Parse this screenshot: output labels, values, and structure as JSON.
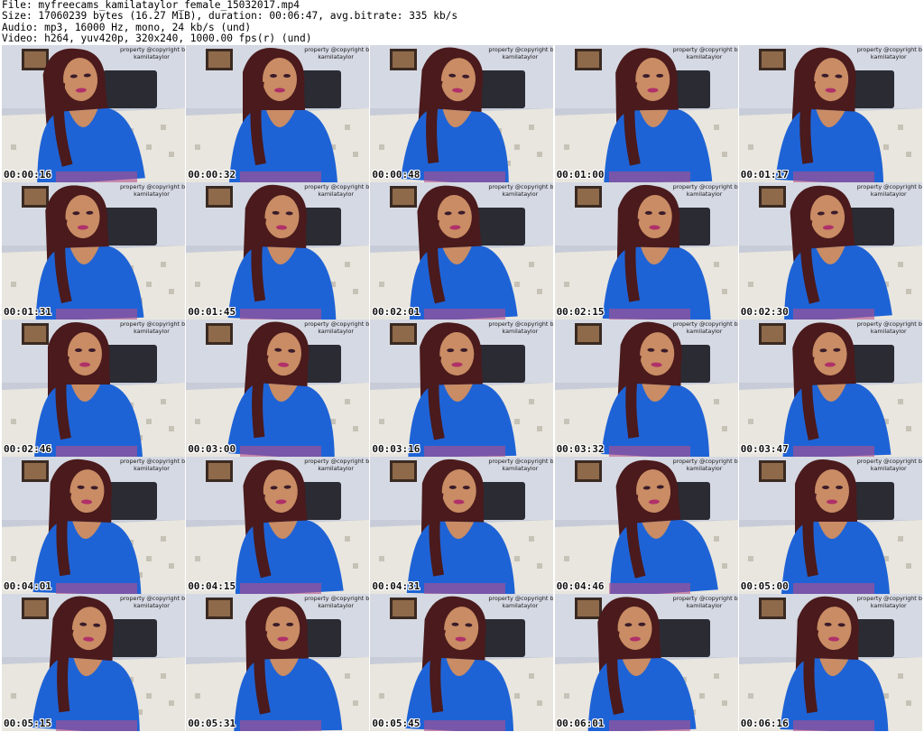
{
  "header": {
    "file": "File: myfreecams_kamilataylor_female_15032017.mp4",
    "size": "Size: 17060239 bytes (16.27 MiB), duration: 00:06:47, avg.bitrate: 335 kb/s",
    "audio": "Audio: mp3, 16000 Hz, mono, 24 kb/s (und)",
    "video": "Video: h264, yuv420p, 320x240, 1000.00 fps(r) (und)"
  },
  "watermark": {
    "line1": "property @copyright b",
    "line2": "kamilataylor"
  },
  "colors": {
    "wall": "#c7ccd8",
    "headboard": "#2b2b33",
    "shirt": "#1e63d6",
    "hair": "#4a1a1c",
    "skin": "#c98c64",
    "bedding": "#e9e6df"
  },
  "frames": [
    {
      "time": "00:00:16"
    },
    {
      "time": "00:00:32"
    },
    {
      "time": "00:00:48"
    },
    {
      "time": "00:01:00"
    },
    {
      "time": "00:01:17"
    },
    {
      "time": "00:01:31"
    },
    {
      "time": "00:01:45"
    },
    {
      "time": "00:02:01"
    },
    {
      "time": "00:02:15"
    },
    {
      "time": "00:02:30"
    },
    {
      "time": "00:02:46"
    },
    {
      "time": "00:03:00"
    },
    {
      "time": "00:03:16"
    },
    {
      "time": "00:03:32"
    },
    {
      "time": "00:03:47"
    },
    {
      "time": "00:04:01"
    },
    {
      "time": "00:04:15"
    },
    {
      "time": "00:04:31"
    },
    {
      "time": "00:04:46"
    },
    {
      "time": "00:05:00"
    },
    {
      "time": "00:05:15"
    },
    {
      "time": "00:05:31"
    },
    {
      "time": "00:05:45"
    },
    {
      "time": "00:06:01"
    },
    {
      "time": "00:06:16"
    }
  ]
}
